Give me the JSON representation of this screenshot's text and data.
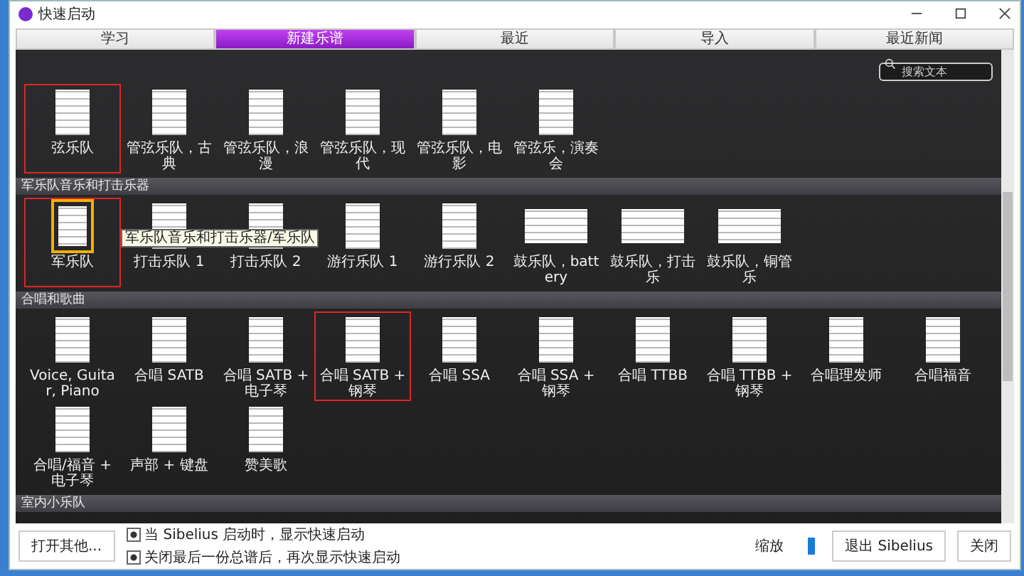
{
  "window": {
    "title": "快速启动"
  },
  "tabs": [
    {
      "label": "学习",
      "selected": false
    },
    {
      "label": "新建乐谱",
      "selected": true
    },
    {
      "label": "最近",
      "selected": false
    },
    {
      "label": "导入",
      "selected": false
    },
    {
      "label": "最近新闻",
      "selected": false
    }
  ],
  "search": {
    "placeholder": "搜索文本"
  },
  "sections": [
    {
      "items": [
        {
          "label": "弦乐队",
          "kind": "portrait",
          "selected": false,
          "highlighted": true
        },
        {
          "label": "管弦乐队，古典",
          "kind": "portrait",
          "selected": false,
          "highlighted": false
        },
        {
          "label": "管弦乐队，浪漫",
          "kind": "portrait",
          "selected": false,
          "highlighted": false
        },
        {
          "label": "管弦乐队，现代",
          "kind": "portrait",
          "selected": false,
          "highlighted": false
        },
        {
          "label": "管弦乐队，电影",
          "kind": "portrait",
          "selected": false,
          "highlighted": false
        },
        {
          "label": "管弦乐，演奏会",
          "kind": "portrait",
          "selected": false,
          "highlighted": false
        }
      ]
    },
    {
      "title": "军乐队音乐和打击乐器",
      "items": [
        {
          "label": "军乐队",
          "kind": "portrait",
          "selected": true,
          "highlighted": true,
          "tooltip": "军乐队音乐和打击乐器/军乐队"
        },
        {
          "label": "打击乐队 1",
          "kind": "portrait",
          "selected": false,
          "highlighted": false
        },
        {
          "label": "打击乐队 2",
          "kind": "portrait",
          "selected": false,
          "highlighted": false
        },
        {
          "label": "游行乐队 1",
          "kind": "portrait",
          "selected": false,
          "highlighted": false
        },
        {
          "label": "游行乐队 2",
          "kind": "portrait",
          "selected": false,
          "highlighted": false
        },
        {
          "label": "鼓乐队，battery",
          "kind": "landscape",
          "selected": false,
          "highlighted": false
        },
        {
          "label": "鼓乐队，打击乐",
          "kind": "landscape",
          "selected": false,
          "highlighted": false
        },
        {
          "label": "鼓乐队，铜管乐",
          "kind": "landscape",
          "selected": false,
          "highlighted": false
        }
      ]
    },
    {
      "title": "合唱和歌曲",
      "items": [
        {
          "label": "Voice, Guitar, Piano",
          "kind": "portrait",
          "selected": false,
          "highlighted": false
        },
        {
          "label": "合唱 SATB",
          "kind": "portrait",
          "selected": false,
          "highlighted": false
        },
        {
          "label": "合唱 SATB + 电子琴",
          "kind": "portrait",
          "selected": false,
          "highlighted": false
        },
        {
          "label": "合唱 SATB + 钢琴",
          "kind": "portrait",
          "selected": false,
          "highlighted": true
        },
        {
          "label": "合唱 SSA",
          "kind": "portrait",
          "selected": false,
          "highlighted": false
        },
        {
          "label": "合唱 SSA + 钢琴",
          "kind": "portrait",
          "selected": false,
          "highlighted": false
        },
        {
          "label": "合唱 TTBB",
          "kind": "portrait",
          "selected": false,
          "highlighted": false
        },
        {
          "label": "合唱 TTBB + 钢琴",
          "kind": "portrait",
          "selected": false,
          "highlighted": false
        },
        {
          "label": "合唱理发师",
          "kind": "portrait",
          "selected": false,
          "highlighted": false
        },
        {
          "label": "合唱福音",
          "kind": "portrait",
          "selected": false,
          "highlighted": false
        },
        {
          "label": "合唱/福音 + 电子琴",
          "kind": "portrait",
          "selected": false,
          "highlighted": false
        },
        {
          "label": "声部 + 键盘",
          "kind": "portrait",
          "selected": false,
          "highlighted": false
        },
        {
          "label": "赞美歌",
          "kind": "portrait",
          "selected": false,
          "highlighted": false
        }
      ]
    },
    {
      "title": "室内小乐队"
    }
  ],
  "footer": {
    "open_button": "打开其他...",
    "options": [
      {
        "label": "当 Sibelius 启动时，显示快速启动",
        "checked": true
      },
      {
        "label": "关闭最后一份总谱后，再次显示快速启动",
        "checked": true
      }
    ],
    "zoom": {
      "label": "缩放",
      "level": 0.5
    },
    "buttons": [
      "退出 Sibelius",
      "关闭"
    ]
  }
}
